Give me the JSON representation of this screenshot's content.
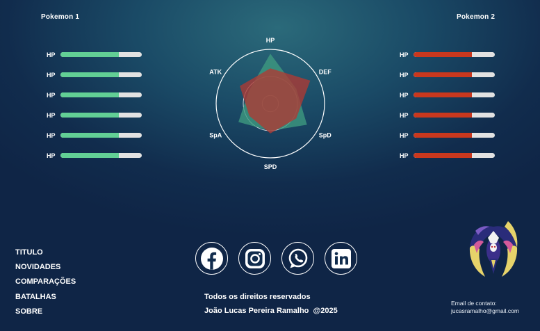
{
  "pokemon1": {
    "title": "Pokemon 1",
    "color": "#62cf95",
    "stats": [
      {
        "label": "HP",
        "value": 0.72
      },
      {
        "label": "HP",
        "value": 0.72
      },
      {
        "label": "HP",
        "value": 0.72
      },
      {
        "label": "HP",
        "value": 0.72
      },
      {
        "label": "HP",
        "value": 0.72
      },
      {
        "label": "HP",
        "value": 0.72
      }
    ]
  },
  "pokemon2": {
    "title": "Pokemon 2",
    "color": "#c9381e",
    "stats": [
      {
        "label": "HP",
        "value": 0.72
      },
      {
        "label": "HP",
        "value": 0.72
      },
      {
        "label": "HP",
        "value": 0.72
      },
      {
        "label": "HP",
        "value": 0.72
      },
      {
        "label": "HP",
        "value": 0.72
      },
      {
        "label": "HP",
        "value": 0.72
      }
    ]
  },
  "radar": {
    "axes": [
      "HP",
      "DEF",
      "SpD",
      "SPD",
      "SpA",
      "ATK"
    ],
    "max": 100,
    "series": [
      {
        "color": "#3f9b80",
        "values": [
          92,
          55,
          78,
          50,
          68,
          46
        ]
      },
      {
        "color": "#b03a33",
        "values": [
          65,
          85,
          55,
          55,
          45,
          65
        ]
      }
    ]
  },
  "nav": {
    "items": [
      "TITULO",
      "NOVIDADES",
      "COMPARAÇÕES",
      "BATALHAS",
      "SOBRE"
    ]
  },
  "socials": {
    "icons": [
      "facebook-icon",
      "instagram-icon",
      "whatsapp-icon",
      "linkedin-icon"
    ]
  },
  "footer": {
    "rights": "Todos os direitos reservados",
    "author": "João Lucas Pereira Ramalho  @2025",
    "contact_label": "Email de contato:",
    "contact_email": "jucasramalho@gmail.com"
  }
}
